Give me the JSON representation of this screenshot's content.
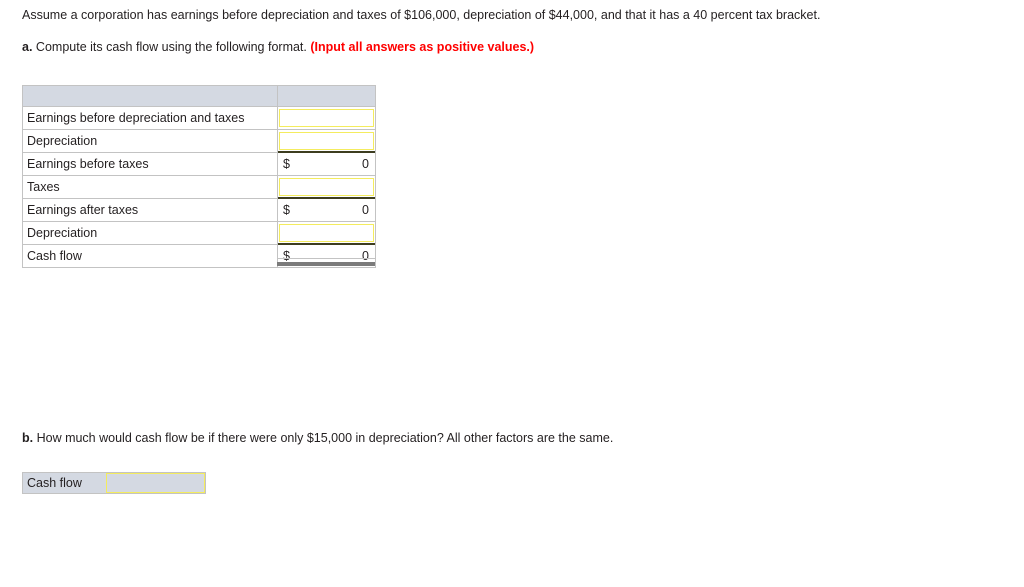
{
  "problem": {
    "statement": "Assume a corporation has earnings before depreciation and taxes of $106,000, depreciation of $44,000, and that it has a 40 percent tax bracket."
  },
  "part_a": {
    "label": "a.",
    "prompt": "Compute its cash flow using the following format.",
    "note": "(Input all answers as positive values.)",
    "table": {
      "header": {
        "label_col": "",
        "value_col": ""
      },
      "rows": [
        {
          "label": "Earnings before depreciation and taxes",
          "type": "input",
          "value": "",
          "currency": "",
          "rule_top": false
        },
        {
          "label": "Depreciation",
          "type": "input",
          "value": "",
          "currency": "",
          "rule_top": false
        },
        {
          "label": "Earnings before taxes",
          "type": "computed",
          "value": "0",
          "currency": "$",
          "rule_top": true
        },
        {
          "label": "Taxes",
          "type": "input",
          "value": "",
          "currency": "",
          "rule_top": false
        },
        {
          "label": "Earnings after taxes",
          "type": "computed",
          "value": "0",
          "currency": "$",
          "rule_top": true
        },
        {
          "label": "Depreciation",
          "type": "input",
          "value": "",
          "currency": "",
          "rule_top": false
        },
        {
          "label": "Cash flow",
          "type": "computed",
          "value": "0",
          "currency": "$",
          "rule_top": true
        }
      ]
    }
  },
  "part_b": {
    "label": "b.",
    "prompt": "How much would cash flow be if there were only $15,000 in depreciation? All other factors are the same.",
    "answer": {
      "label": "Cash flow",
      "value": "",
      "placeholder": ""
    }
  },
  "colors": {
    "header_fill": "#d4d9e2",
    "input_border": "#f4ec5e",
    "grid_border": "#c3c3c3",
    "note_red": "#ff0000",
    "rule_dark": "#3d3d1f",
    "total_underline": "#7b7b7b",
    "text": "#231f20"
  }
}
